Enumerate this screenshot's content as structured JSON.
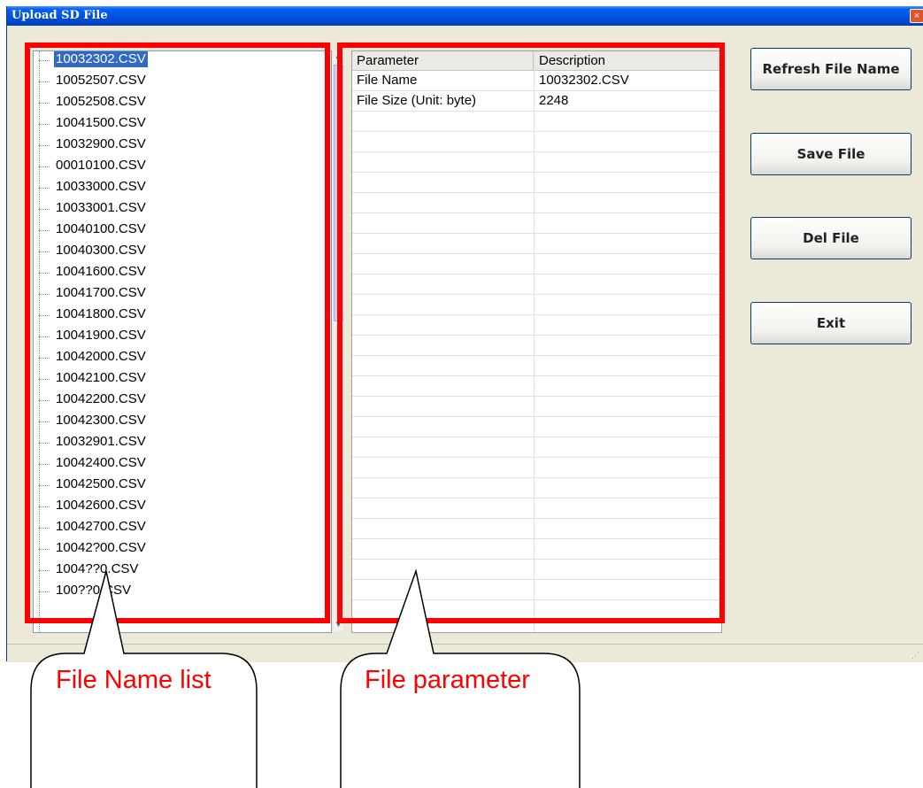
{
  "window": {
    "title": "Upload SD File",
    "close_glyph": "×"
  },
  "file_list": {
    "selected_index": 0,
    "items": [
      "10032302.CSV",
      "10052507.CSV",
      "10052508.CSV",
      "10041500.CSV",
      "10032900.CSV",
      "00010100.CSV",
      "10033000.CSV",
      "10033001.CSV",
      "10040100.CSV",
      "10040300.CSV",
      "10041600.CSV",
      "10041700.CSV",
      "10041800.CSV",
      "10041900.CSV",
      "10042000.CSV",
      "10042100.CSV",
      "10042200.CSV",
      "10042300.CSV",
      "10032901.CSV",
      "10042400.CSV",
      "10042500.CSV",
      "10042600.CSV",
      "10042700.CSV",
      "10042?00.CSV",
      "1004??0.CSV",
      "100??0.CSV"
    ],
    "scroll": {
      "up": "▲",
      "down": "▼"
    }
  },
  "param_grid": {
    "headers": [
      "Parameter",
      "Description"
    ],
    "rows": [
      [
        "File Name",
        "10032302.CSV"
      ],
      [
        "File Size (Unit: byte)",
        "2248"
      ]
    ],
    "empty_rows": 25
  },
  "buttons": {
    "refresh": "Refresh File Name",
    "save": "Save File",
    "del": "Del File",
    "exit": "Exit"
  },
  "callouts": {
    "file_list": "File Name list",
    "file_param": "File parameter"
  },
  "colors": {
    "highlight": "#ff0000",
    "selection": "#316ac5"
  }
}
